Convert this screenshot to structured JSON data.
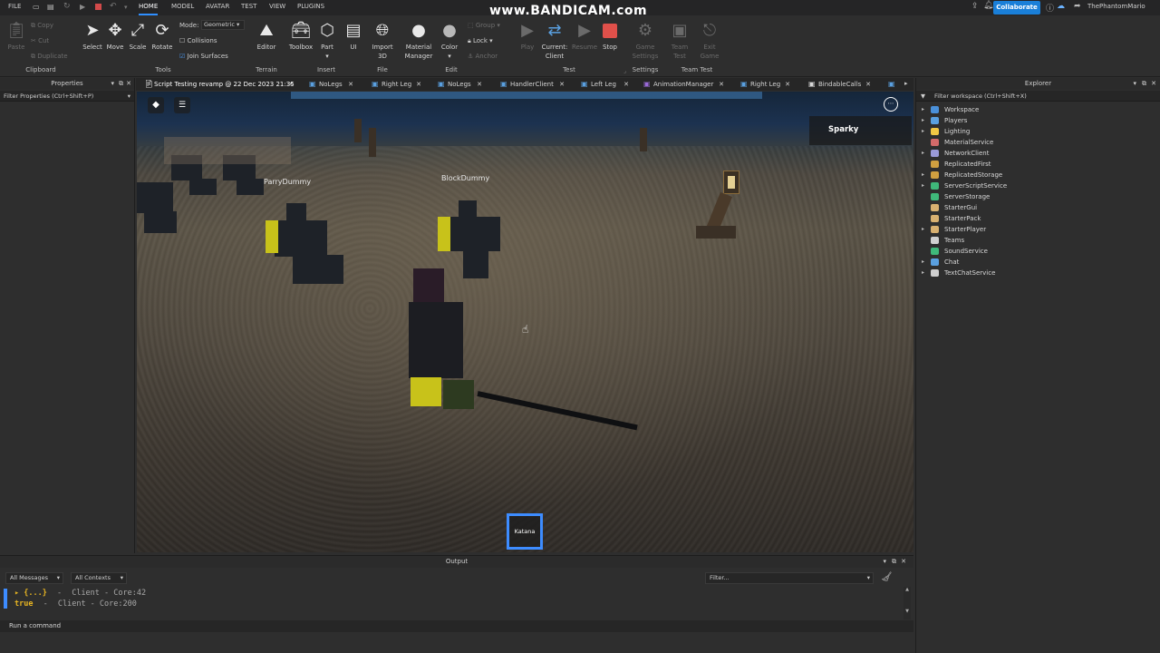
{
  "menubar": {
    "file": "FILE",
    "tabs": [
      "HOME",
      "MODEL",
      "AVATAR",
      "TEST",
      "VIEW",
      "PLUGINS"
    ],
    "watermark": "www.BANDICAM.com",
    "collaborate": "Collaborate",
    "user": "ThePhantomMario"
  },
  "ribbon": {
    "clipboard": {
      "paste": "Paste",
      "copy": "Copy",
      "cut": "Cut",
      "duplicate": "Duplicate",
      "label": "Clipboard"
    },
    "tools": {
      "select": "Select",
      "move": "Move",
      "scale": "Scale",
      "rotate": "Rotate",
      "mode_label": "Mode:",
      "mode_value": "Geometric",
      "collisions": "Collisions",
      "join_surfaces": "Join Surfaces",
      "label": "Tools"
    },
    "terrain": {
      "editor": "Editor",
      "label": "Terrain"
    },
    "insert": {
      "toolbox": "Toolbox",
      "part": "Part",
      "ui": "UI",
      "label": "Insert"
    },
    "file": {
      "import_3d": "Import 3D",
      "label": "File"
    },
    "edit": {
      "material_manager": "Material Manager",
      "color": "Color",
      "group": "Group",
      "lock": "Lock",
      "anchor": "Anchor",
      "label": "Edit"
    },
    "test": {
      "play": "Play",
      "current_client": "Current: Client",
      "resume": "Resume",
      "stop": "Stop",
      "label": "Test"
    },
    "settings": {
      "game_settings": "Game Settings",
      "label": "Settings"
    },
    "team_test": {
      "team_test": "Team Test",
      "exit_game": "Exit Game",
      "label": "Team Test"
    }
  },
  "doc_tabs": [
    {
      "label": "Script Testing revamp @ 22 Dec 2023 21:35"
    },
    {
      "label": "NoLegs"
    },
    {
      "label": "Right Leg"
    },
    {
      "label": "NoLegs"
    },
    {
      "label": "HandlerClient"
    },
    {
      "label": "Left Leg"
    },
    {
      "label": "AnimationManager"
    },
    {
      "label": "Right Leg"
    },
    {
      "label": "BindableCalls"
    }
  ],
  "properties": {
    "title": "Properties",
    "filter": "Filter Properties (Ctrl+Shift+P)"
  },
  "explorer": {
    "title": "Explorer",
    "filter": "Filter workspace (Ctrl+Shift+X)",
    "items": [
      {
        "label": "Workspace",
        "expandable": true,
        "color": "#4a90d9"
      },
      {
        "label": "Players",
        "expandable": true,
        "color": "#5aa0e0"
      },
      {
        "label": "Lighting",
        "expandable": true,
        "color": "#f2c744"
      },
      {
        "label": "MaterialService",
        "expandable": false,
        "color": "#d46a6a"
      },
      {
        "label": "NetworkClient",
        "expandable": true,
        "color": "#9a9ad8"
      },
      {
        "label": "ReplicatedFirst",
        "expandable": false,
        "color": "#d0a040"
      },
      {
        "label": "ReplicatedStorage",
        "expandable": true,
        "color": "#d0a040"
      },
      {
        "label": "ServerScriptService",
        "expandable": true,
        "color": "#3fb87a"
      },
      {
        "label": "ServerStorage",
        "expandable": false,
        "color": "#3fb87a"
      },
      {
        "label": "StarterGui",
        "expandable": false,
        "color": "#d8b070"
      },
      {
        "label": "StarterPack",
        "expandable": false,
        "color": "#d8b070"
      },
      {
        "label": "StarterPlayer",
        "expandable": true,
        "color": "#d8b070"
      },
      {
        "label": "Teams",
        "expandable": false,
        "color": "#d0d0d0"
      },
      {
        "label": "SoundService",
        "expandable": false,
        "color": "#3fb87a"
      },
      {
        "label": "Chat",
        "expandable": true,
        "color": "#5aa0e0"
      },
      {
        "label": "TextChatService",
        "expandable": true,
        "color": "#cfcfcf"
      }
    ]
  },
  "viewport": {
    "nametags": [
      "ParryDummy",
      "BlockDummy"
    ],
    "player_card": "Sparky",
    "hotbar_item": "Katana"
  },
  "output": {
    "title": "Output",
    "messages_filter": "All Messages",
    "contexts_filter": "All Contexts",
    "search_placeholder": "Filter...",
    "lines": [
      {
        "text": "▸ {...}",
        "sep": "-",
        "source": "Client - Core:42"
      },
      {
        "text": "true",
        "sep": "-",
        "source": "Client - Core:200"
      }
    ],
    "command_placeholder": "Run a command"
  },
  "colors": {
    "accent": "#2f8fff",
    "collaborate": "#1a7fd8",
    "stop": "#e0504a",
    "output_value": "#e6b422"
  }
}
